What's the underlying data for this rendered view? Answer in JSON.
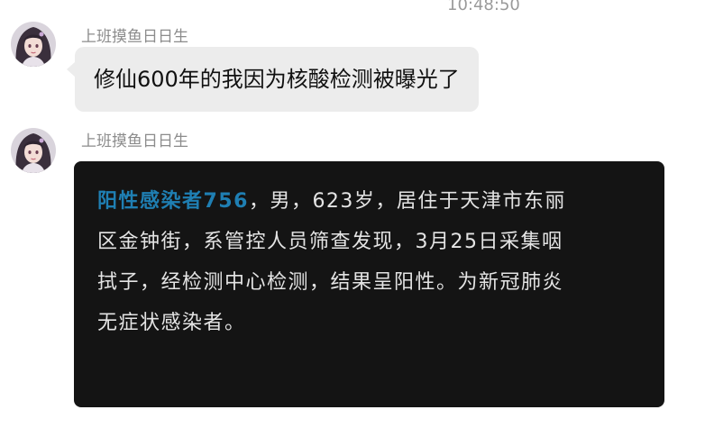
{
  "chat": {
    "timestamp": "10:48:50",
    "messages": [
      {
        "sender": "上班摸鱼日日生",
        "avatar_icon": "anime-girl-avatar",
        "text": "修仙600年的我因为核酸检测被曝光了"
      },
      {
        "sender": "上班摸鱼日日生",
        "avatar_icon": "anime-girl-avatar",
        "image_text": {
          "highlight": "阳性感染者756",
          "line1_rest": "，男，623岁，居住于天津市东丽",
          "line2": "区金钟街，系管控人员筛查发现，3月25日采集咽",
          "line3": "拭子，经检测中心检测，结果呈阳性。为新冠肺炎",
          "line4": "无症状感染者。"
        }
      }
    ]
  },
  "colors": {
    "bubble": "#ececec",
    "image_background": "#141414",
    "highlight_text": "#1f7fb3",
    "image_text": "#e4e4e4",
    "sender_name": "#8c8c8c"
  }
}
